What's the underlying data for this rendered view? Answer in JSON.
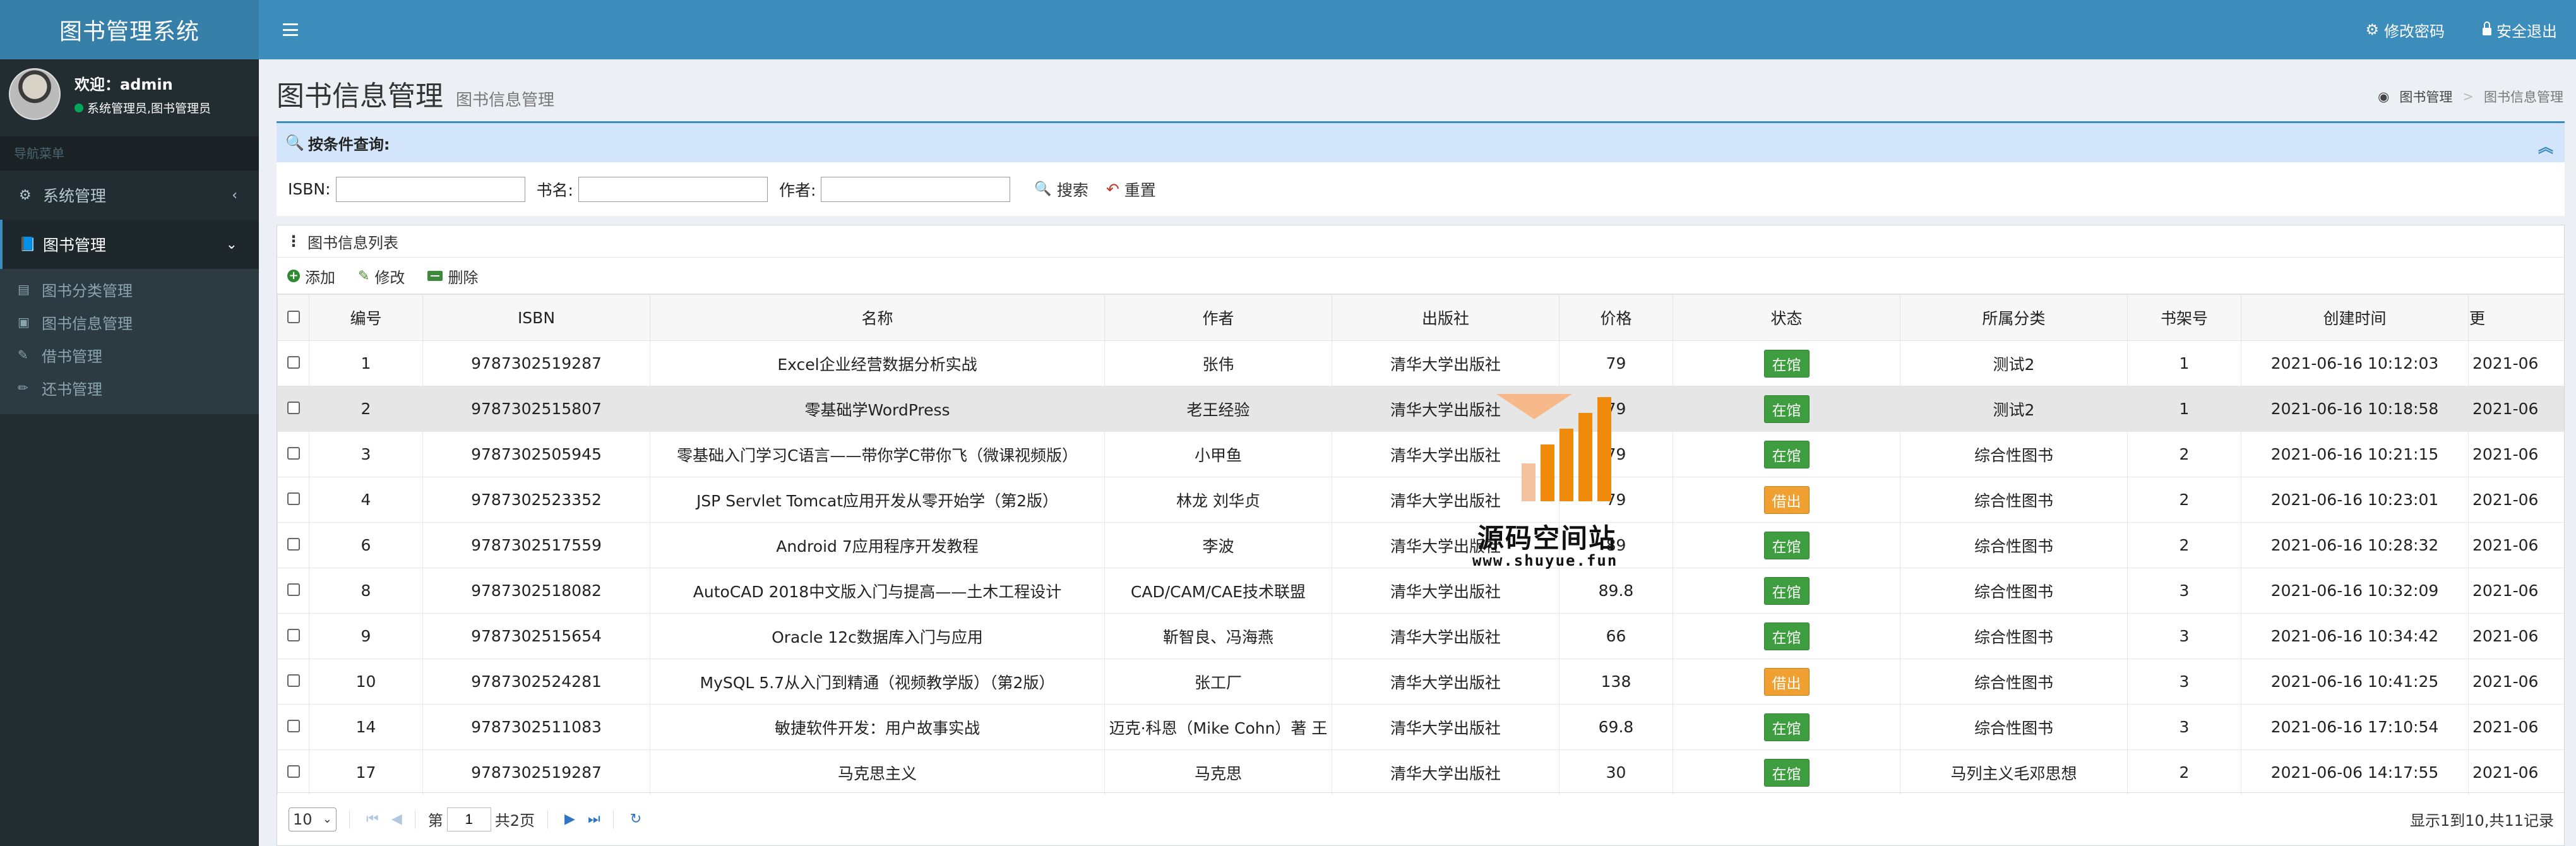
{
  "app": {
    "title": "图书管理系统"
  },
  "topbar": {
    "change_password": "修改密码",
    "logout": "安全退出"
  },
  "user": {
    "welcome": "欢迎：admin",
    "role": "系统管理员,图书管理员"
  },
  "nav": {
    "header": "导航菜单",
    "items": [
      {
        "label": "系统管理"
      },
      {
        "label": "图书管理"
      }
    ],
    "sub_items": [
      {
        "label": "图书分类管理"
      },
      {
        "label": "图书信息管理"
      },
      {
        "label": "借书管理"
      },
      {
        "label": "还书管理"
      }
    ]
  },
  "page": {
    "title": "图书信息管理",
    "subtitle": "图书信息管理",
    "breadcrumb": [
      "图书管理",
      "图书信息管理"
    ]
  },
  "search": {
    "header": "按条件查询:",
    "isbn_label": "ISBN:",
    "name_label": "书名:",
    "author_label": "作者:",
    "isbn_value": "",
    "name_value": "",
    "author_value": "",
    "search_btn": "搜索",
    "reset_btn": "重置"
  },
  "table": {
    "title": "图书信息列表",
    "toolbar": {
      "add": "添加",
      "edit": "修改",
      "delete": "删除"
    },
    "columns": [
      "编号",
      "ISBN",
      "名称",
      "作者",
      "出版社",
      "价格",
      "状态",
      "所属分类",
      "书架号",
      "创建时间",
      "更"
    ],
    "rows": [
      {
        "id": "1",
        "isbn": "9787302519287",
        "name": "Excel企业经营数据分析实战",
        "author": "张伟",
        "publisher": "清华大学出版社",
        "price": "79",
        "status": "在馆",
        "category": "测试2",
        "shelf": "1",
        "created": "2021-06-16 10:12:03",
        "updated": "2021-06"
      },
      {
        "id": "2",
        "isbn": "9787302515807",
        "name": "零基础学WordPress",
        "author": "老王经验",
        "publisher": "清华大学出版社",
        "price": "79",
        "status": "在馆",
        "category": "测试2",
        "shelf": "1",
        "created": "2021-06-16 10:18:58",
        "updated": "2021-06"
      },
      {
        "id": "3",
        "isbn": "9787302505945",
        "name": "零基础入门学习C语言——带你学C带你飞（微课视频版）",
        "author": "小甲鱼",
        "publisher": "清华大学出版社",
        "price": "79",
        "status": "在馆",
        "category": "综合性图书",
        "shelf": "2",
        "created": "2021-06-16 10:21:15",
        "updated": "2021-06"
      },
      {
        "id": "4",
        "isbn": "9787302523352",
        "name": "JSP Servlet Tomcat应用开发从零开始学（第2版）",
        "author": "林龙 刘华贞",
        "publisher": "清华大学出版社",
        "price": "79",
        "status": "借出",
        "category": "综合性图书",
        "shelf": "2",
        "created": "2021-06-16 10:23:01",
        "updated": "2021-06"
      },
      {
        "id": "6",
        "isbn": "9787302517559",
        "name": "Android 7应用程序开发教程",
        "author": "李波",
        "publisher": "清华大学出版社",
        "price": "89",
        "status": "在馆",
        "category": "综合性图书",
        "shelf": "2",
        "created": "2021-06-16 10:28:32",
        "updated": "2021-06"
      },
      {
        "id": "8",
        "isbn": "9787302518082",
        "name": "AutoCAD 2018中文版入门与提高——土木工程设计",
        "author": "CAD/CAM/CAE技术联盟",
        "publisher": "清华大学出版社",
        "price": "89.8",
        "status": "在馆",
        "category": "综合性图书",
        "shelf": "3",
        "created": "2021-06-16 10:32:09",
        "updated": "2021-06"
      },
      {
        "id": "9",
        "isbn": "9787302515654",
        "name": "Oracle 12c数据库入门与应用",
        "author": "靳智良、冯海燕",
        "publisher": "清华大学出版社",
        "price": "66",
        "status": "在馆",
        "category": "综合性图书",
        "shelf": "3",
        "created": "2021-06-16 10:34:42",
        "updated": "2021-06"
      },
      {
        "id": "10",
        "isbn": "9787302524281",
        "name": "MySQL 5.7从入门到精通（视频教学版）（第2版）",
        "author": "张工厂",
        "publisher": "清华大学出版社",
        "price": "138",
        "status": "借出",
        "category": "综合性图书",
        "shelf": "3",
        "created": "2021-06-16 10:41:25",
        "updated": "2021-06"
      },
      {
        "id": "14",
        "isbn": "9787302511083",
        "name": "敏捷软件开发：用户故事实战",
        "author": "迈克·科恩（Mike Cohn）著 王",
        "publisher": "清华大学出版社",
        "price": "69.8",
        "status": "在馆",
        "category": "综合性图书",
        "shelf": "3",
        "created": "2021-06-16 17:10:54",
        "updated": "2021-06"
      },
      {
        "id": "17",
        "isbn": "9787302519287",
        "name": "马克思主义",
        "author": "马克思",
        "publisher": "清华大学出版社",
        "price": "30",
        "status": "在馆",
        "category": "马列主义毛邓思想",
        "shelf": "2",
        "created": "2021-06-06 14:17:55",
        "updated": "2021-06"
      }
    ]
  },
  "pager": {
    "page_size": "10",
    "page_prefix": "第",
    "page_value": "1",
    "page_total": "共2页",
    "record_info": "显示1到10,共11记录"
  },
  "watermark": {
    "text": "源码空间站",
    "url": "www.shuyue.fun"
  },
  "colors": {
    "header_bg": "#3c8dbc",
    "logo_bg": "#367fa9",
    "sidebar_bg": "#222d32",
    "status_in": "#3e9d3e",
    "status_out": "#f0a030"
  }
}
